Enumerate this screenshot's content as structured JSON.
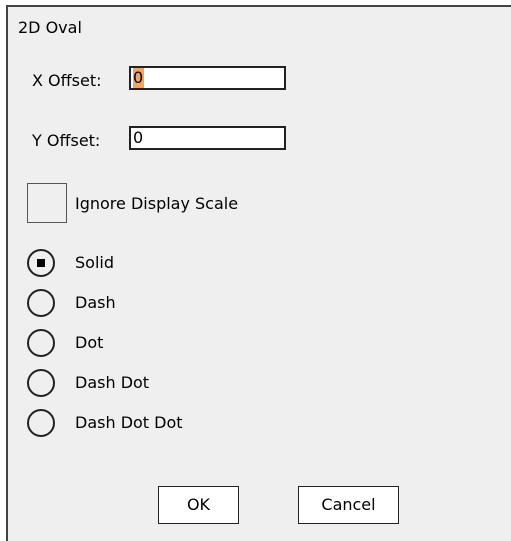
{
  "dialog": {
    "title": "2D Oval",
    "x_offset": {
      "label": "X Offset:",
      "value": "0"
    },
    "y_offset": {
      "label": "Y Offset:",
      "value": "0"
    },
    "ignore_display_scale": {
      "label": "Ignore Display Scale",
      "checked": false
    },
    "line_styles": [
      {
        "label": "Solid",
        "selected": true
      },
      {
        "label": "Dash",
        "selected": false
      },
      {
        "label": "Dot",
        "selected": false
      },
      {
        "label": "Dash Dot",
        "selected": false
      },
      {
        "label": "Dash Dot Dot",
        "selected": false
      }
    ],
    "ok_label": "OK",
    "cancel_label": "Cancel"
  },
  "colors": {
    "dialog_background": "#efefef",
    "text_selection": "#f4a460"
  }
}
